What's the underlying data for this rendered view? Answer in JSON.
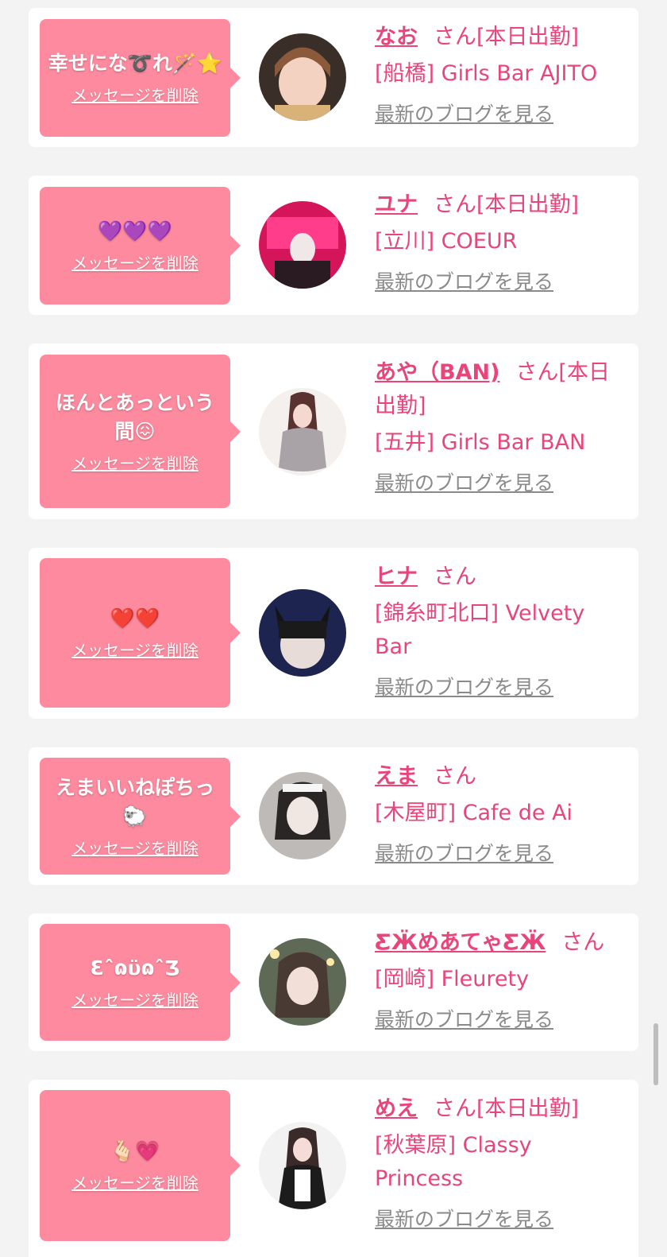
{
  "common": {
    "delete_label": "メッセージを削除",
    "san_label": "さん",
    "blog_label": "最新のブログを見る"
  },
  "cards": [
    {
      "message": "幸せにな➰れ🪄⭐️",
      "name": "なお",
      "status": "[本日出勤]",
      "shop": "[船橋] Girls Bar AJITO"
    },
    {
      "message": "💜💜💜",
      "name": "ユナ",
      "status": "[本日出勤]",
      "shop": "[立川] COEUR"
    },
    {
      "message": "ほんとあっという間😖",
      "name": "あや（BAN)",
      "status": "[本日出勤]",
      "shop": "[五井] Girls Bar BAN"
    },
    {
      "message": "❤️❤️",
      "name": "ヒナ",
      "status": "",
      "shop": "[錦糸町北口] Velvety Bar"
    },
    {
      "message": "えまいいねぽちっ🐑",
      "name": "えま",
      "status": "",
      "shop": "[木屋町] Cafe de Ai"
    },
    {
      "message": "ƐˆɷϋɷˆƷ",
      "name": "ƸӜめあてゃƸӜ",
      "status": "",
      "shop": "[岡崎] Fleurety"
    },
    {
      "message": "🫰🏻💗",
      "name": "めえ",
      "status": "[本日出勤]",
      "shop": "[秋葉原] Classy Princess"
    }
  ],
  "colors": {
    "accent": "#e8457a",
    "bubble": "#fd8a9e",
    "background": "#f3f3f3",
    "card": "#ffffff",
    "link_gray": "#8a8a8a"
  }
}
